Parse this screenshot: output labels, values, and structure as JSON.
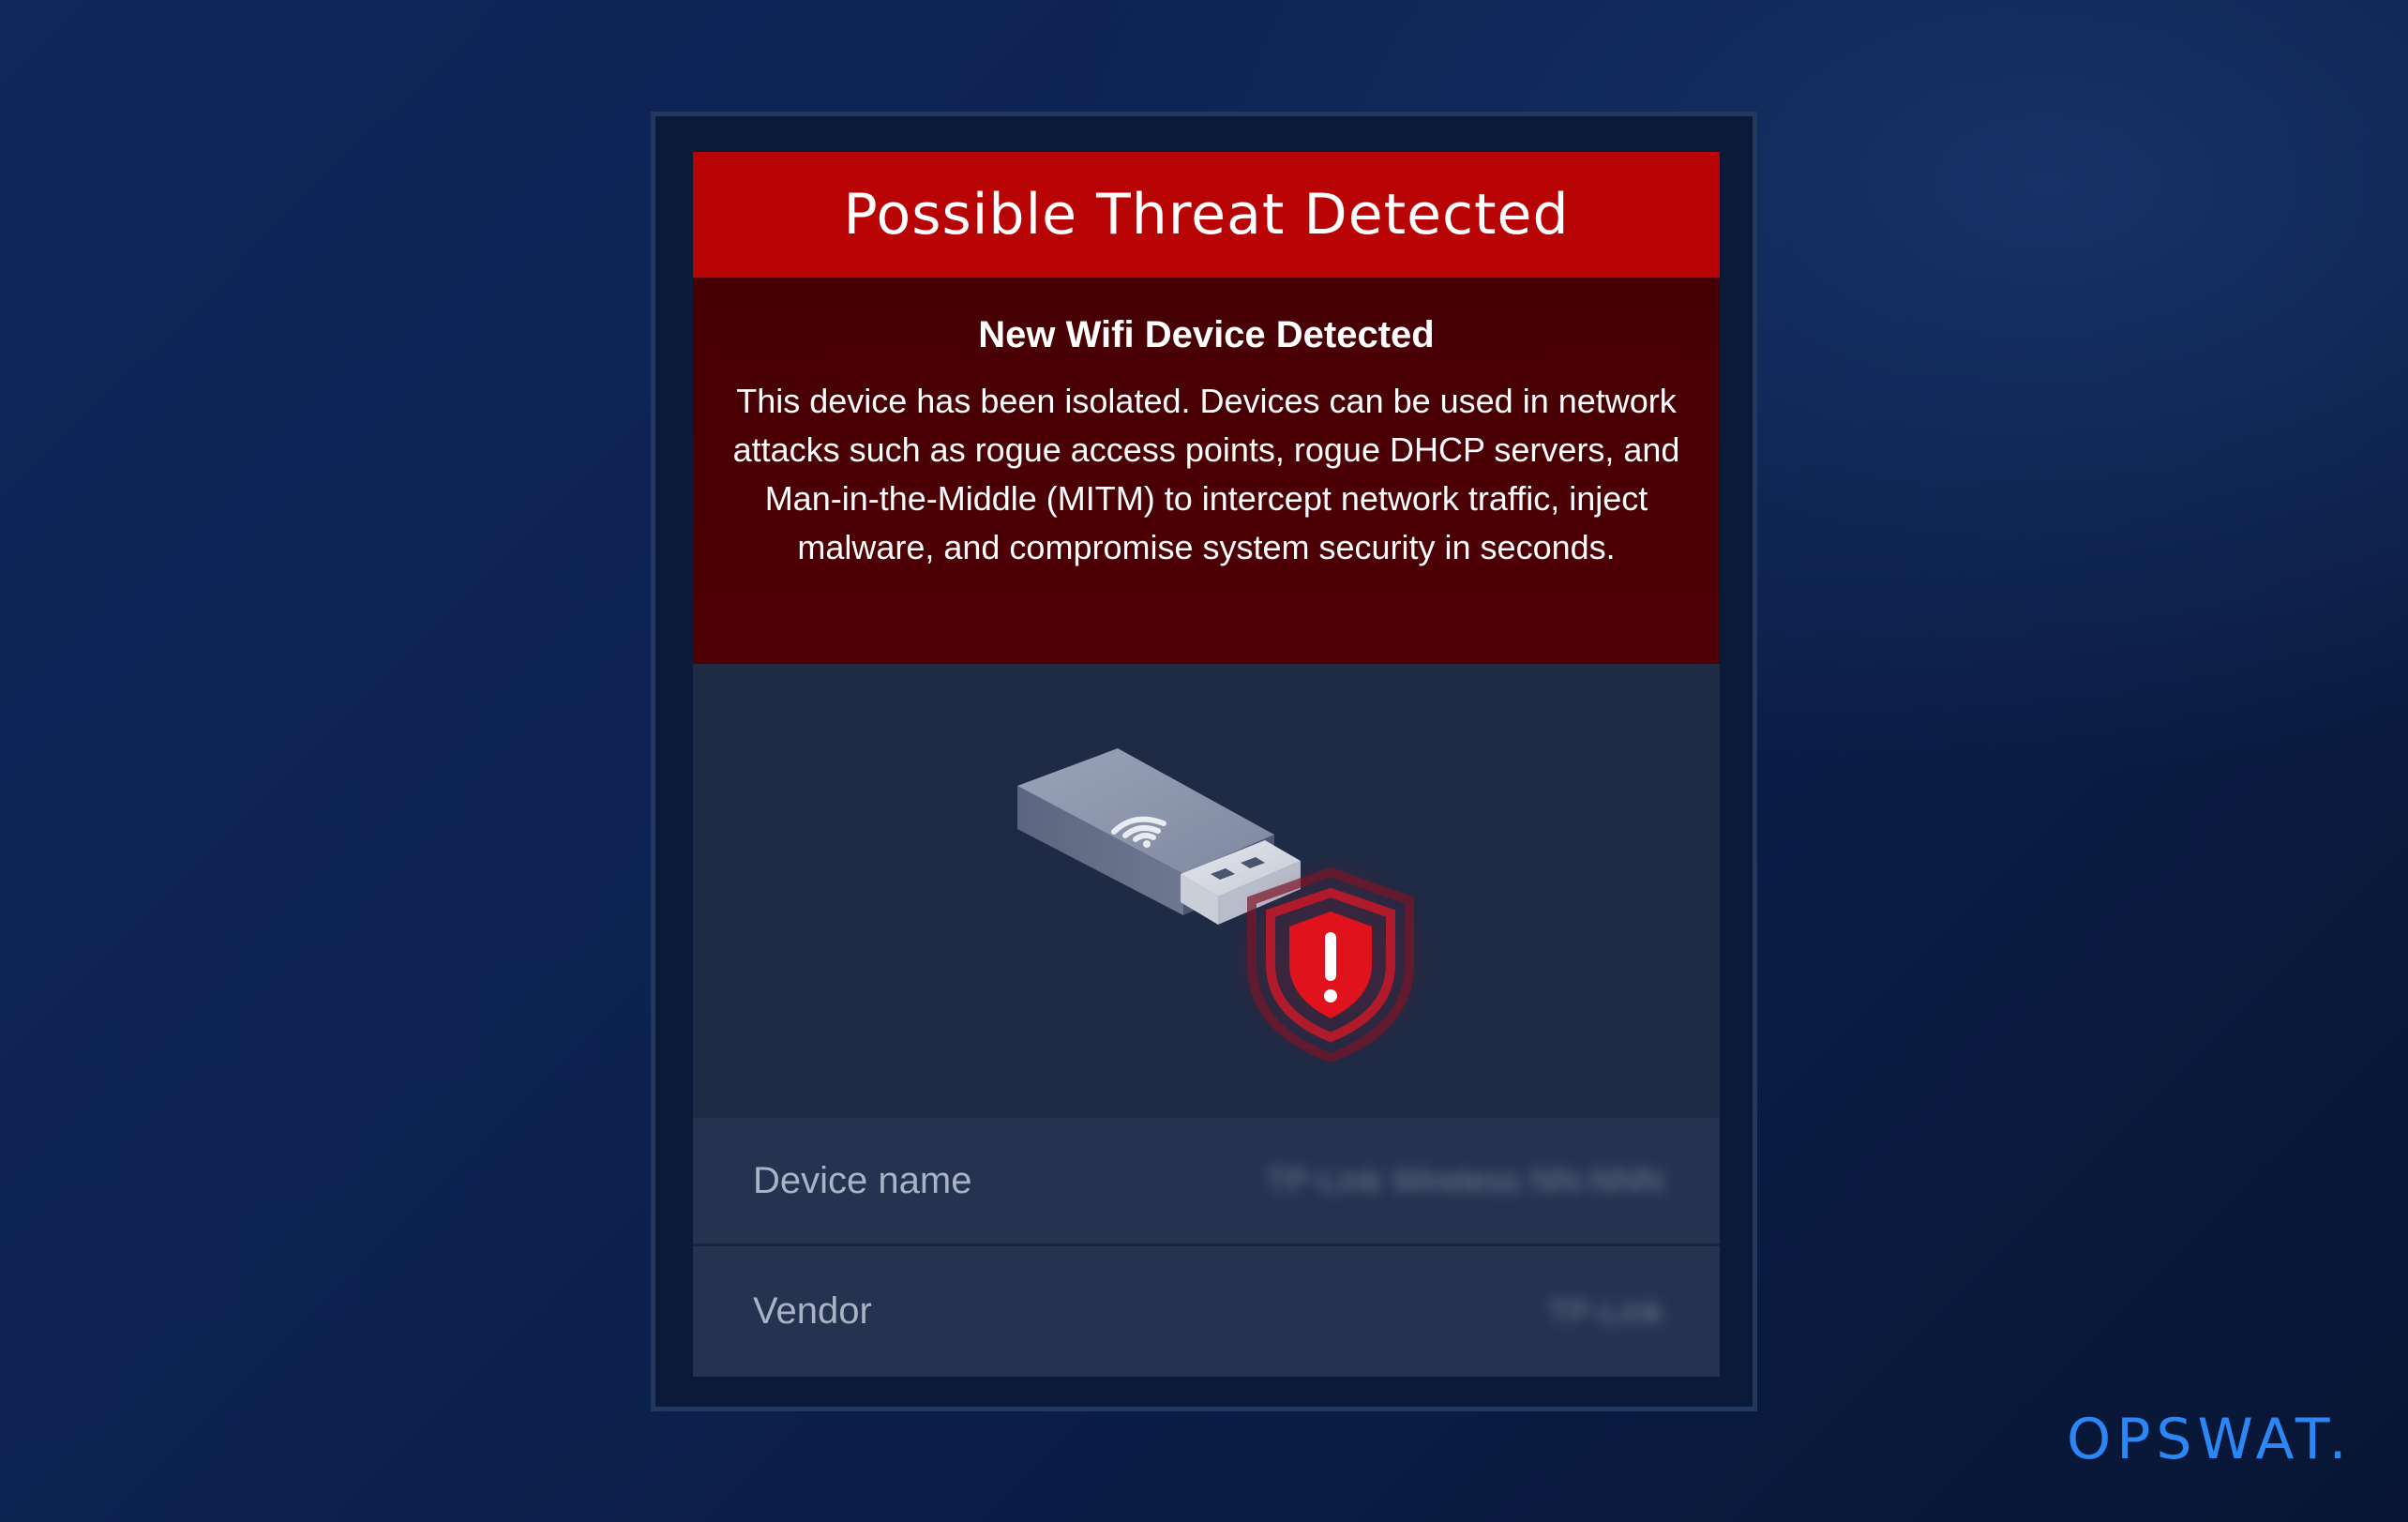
{
  "alert": {
    "title": "Possible Threat Detected",
    "subtitle": "New Wifi Device Detected",
    "description": "This device has been isolated. Devices can be used in network attacks such as rogue access points, rogue DHCP servers, and Man-in-the-Middle (MITM) to intercept network traffic, inject malware, and compromise system security in seconds."
  },
  "illustration": {
    "device_icon": "usb-wifi-adapter-icon",
    "threat_icon": "shield-exclamation-icon"
  },
  "details": {
    "device_name_label": "Device name",
    "device_name_value": "TP-Link Wireless NN-NNN",
    "vendor_label": "Vendor",
    "vendor_value": "TP-Link"
  },
  "brand": {
    "logo_text": "OPSWAT."
  },
  "colors": {
    "alert_red": "#b80404",
    "alert_body": "#4a0004",
    "brand_blue": "#2c86f5"
  }
}
